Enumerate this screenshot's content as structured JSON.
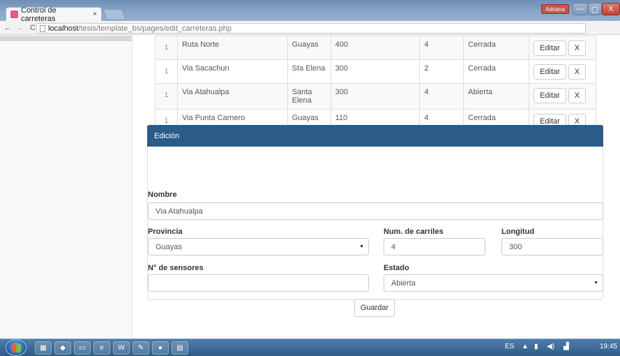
{
  "browser": {
    "tab_title": "Control de carreteras",
    "tab_close": "×",
    "user_label": "Adriana",
    "url_host": "localhost",
    "url_path": "/tesis/template_bs/pages/edit_carreteras.php",
    "window_controls": {
      "minimize": "—",
      "maximize": "▢",
      "close": "X"
    }
  },
  "table": {
    "rows": [
      {
        "id": "1",
        "name": "Ruta Norte",
        "province": "Guayas",
        "length": "400",
        "lanes": "4",
        "status": "Cerrada"
      },
      {
        "id": "1",
        "name": "Via Sacachun",
        "province": "Sta Elena",
        "length": "300",
        "lanes": "2",
        "status": "Cerrada"
      },
      {
        "id": "1",
        "name": "Via Atahualpa",
        "province": "Santa Elena",
        "length": "300",
        "lanes": "4",
        "status": "Abierta"
      },
      {
        "id": "1",
        "name": "Via Punta Carnero",
        "province": "Guayas",
        "length": "110",
        "lanes": "4",
        "status": "Cerrada"
      }
    ],
    "edit_label": "Editar",
    "delete_label": "X"
  },
  "form": {
    "heading": "Edición",
    "nombre_label": "Nombre",
    "nombre_value": "Via Atahualpa",
    "provincia_label": "Provincia",
    "provincia_value": "Guayas",
    "carriles_label": "Num. de carriles",
    "carriles_value": "4",
    "longitud_label": "Longitud",
    "longitud_value": "300",
    "sensores_label": "N° de sensores",
    "sensores_value": "",
    "estado_label": "Estado",
    "estado_value": "Abierta",
    "save_label": "Guardar"
  },
  "taskbar": {
    "lang": "ES",
    "clock": "19:45"
  }
}
